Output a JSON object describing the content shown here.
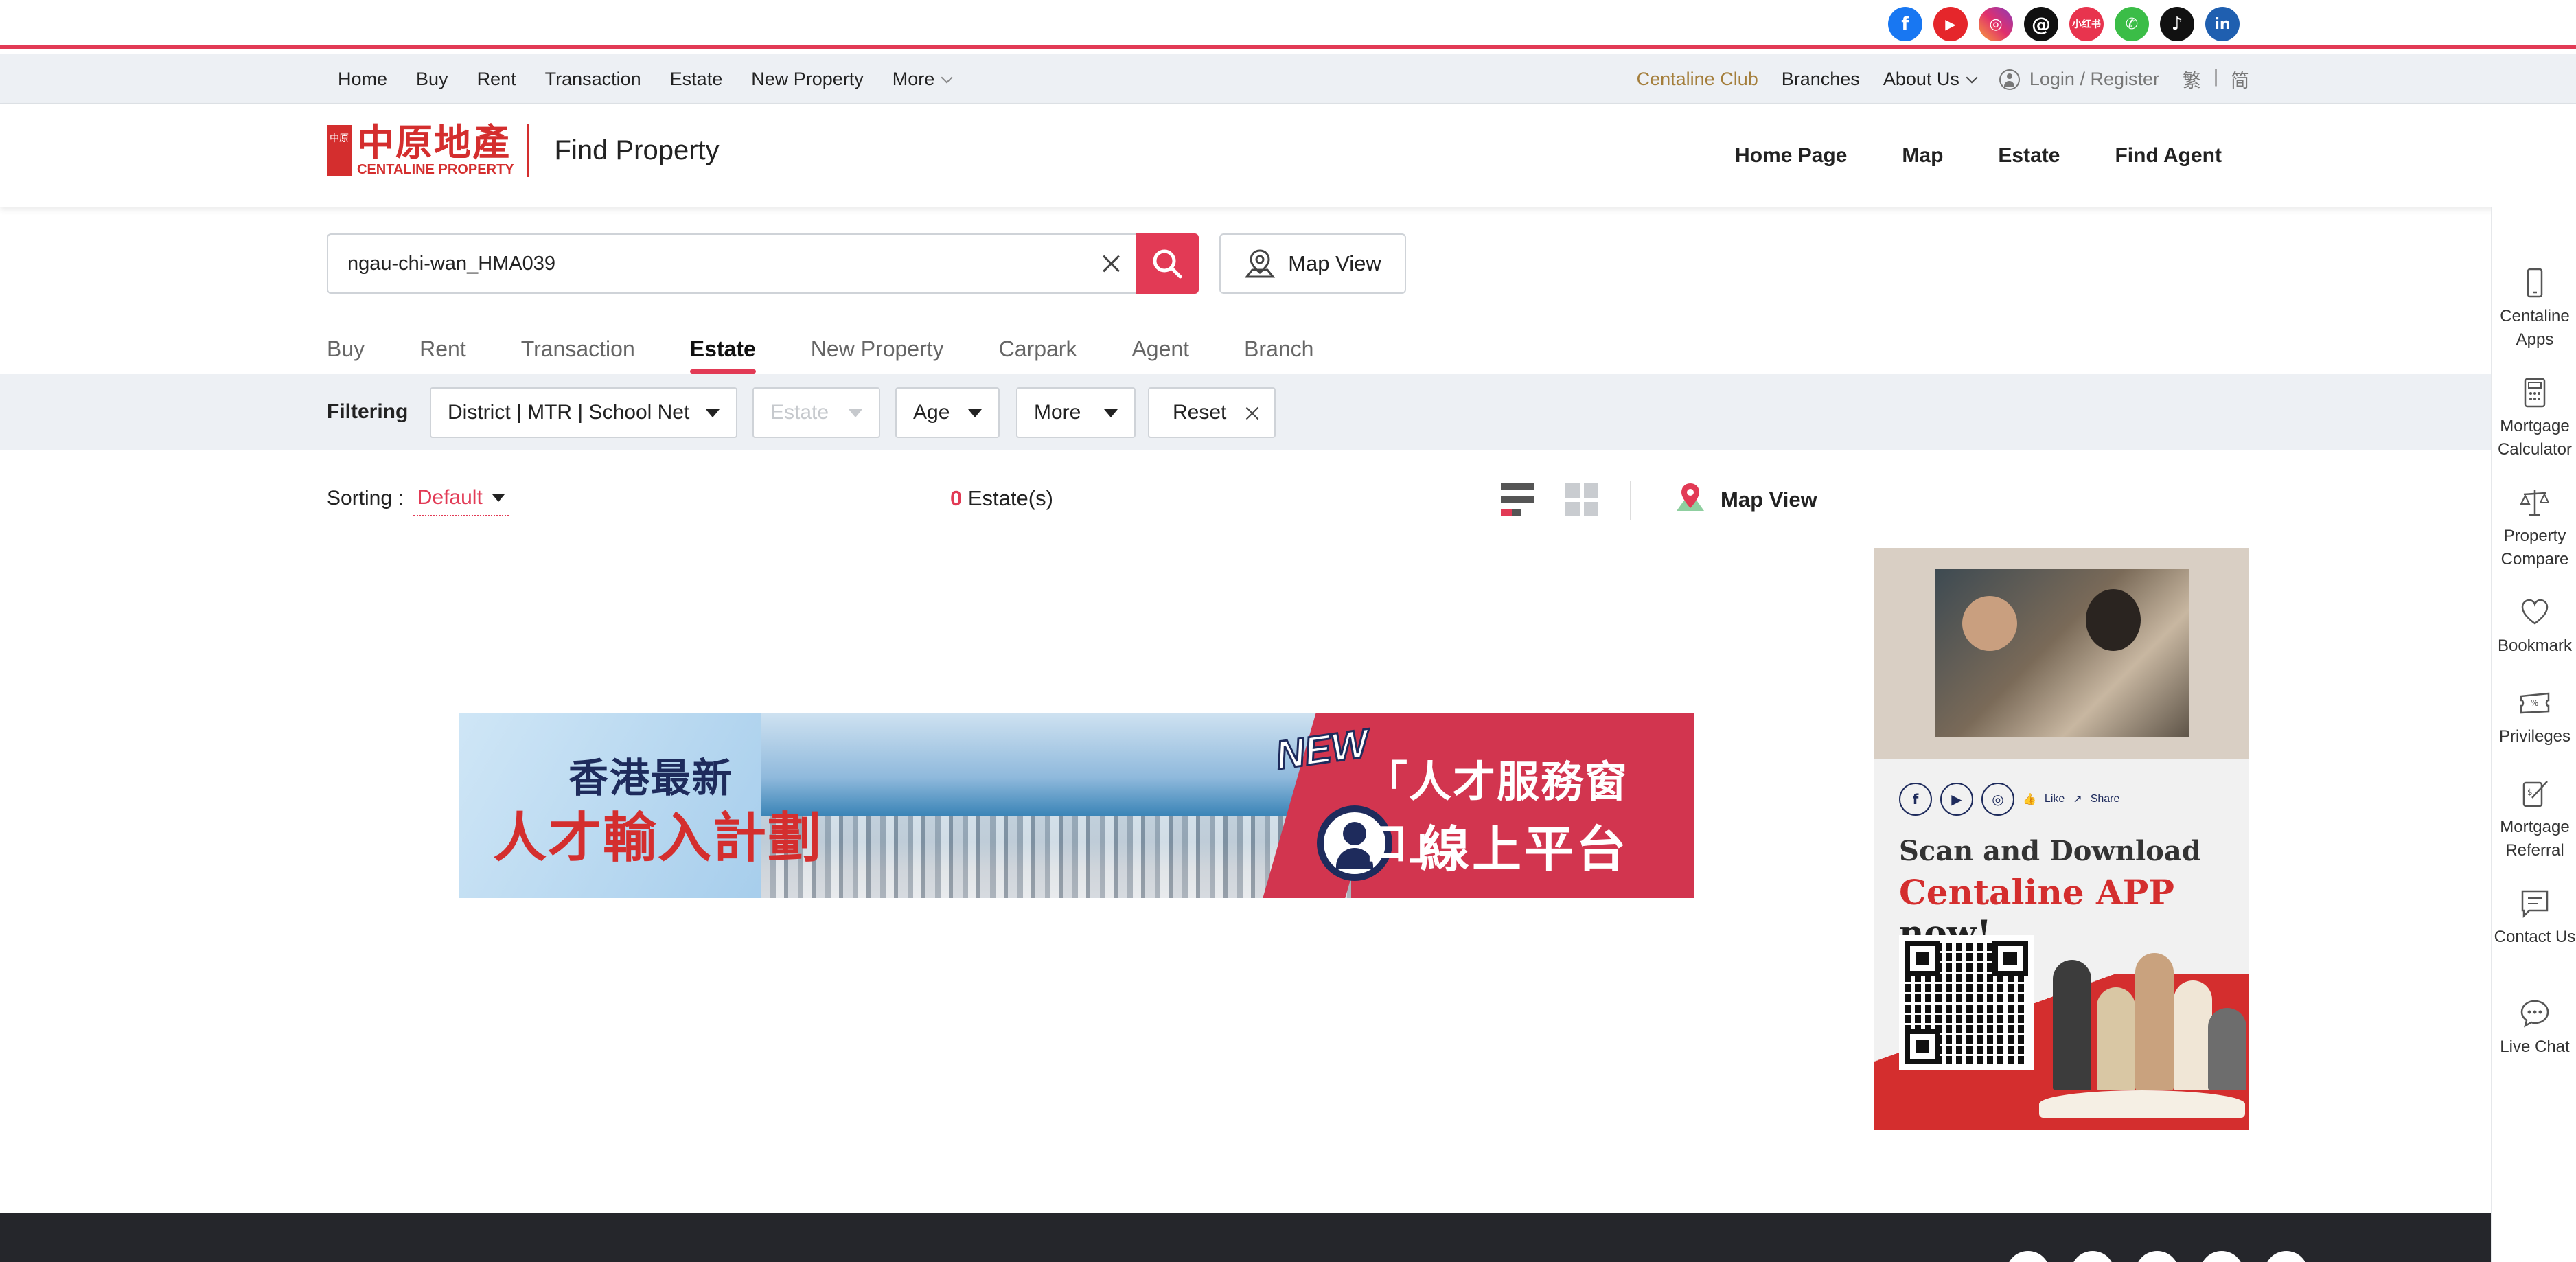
{
  "colors": {
    "brand_red": "#e23a55",
    "logo_red": "#d42e2e",
    "club_gold": "#a47e3b",
    "nav_bg": "#edf0f4",
    "footer_bg": "#25262b"
  },
  "social": [
    {
      "name": "facebook-icon",
      "glyph": "f"
    },
    {
      "name": "youtube-icon",
      "glyph": "▶"
    },
    {
      "name": "instagram-icon",
      "glyph": "◎"
    },
    {
      "name": "threads-icon",
      "glyph": "@"
    },
    {
      "name": "xiaohongshu-icon",
      "glyph": "小红书"
    },
    {
      "name": "wechat-icon",
      "glyph": "✆"
    },
    {
      "name": "tiktok-icon",
      "glyph": "♪"
    },
    {
      "name": "linkedin-icon",
      "glyph": "in"
    }
  ],
  "top_nav": {
    "left": [
      "Home",
      "Buy",
      "Rent",
      "Transaction",
      "Estate",
      "New Property",
      "More"
    ],
    "club": "Centaline Club",
    "branches": "Branches",
    "about": "About Us",
    "login": "Login / Register",
    "lang_trad": "繁",
    "lang_sep": "|",
    "lang_simp": "简"
  },
  "header": {
    "logo_seal": "中原",
    "logo_cn": "中原地產",
    "logo_en": "CENTALINE PROPERTY",
    "title": "Find Property",
    "nav": [
      "Home Page",
      "Map",
      "Estate",
      "Find Agent"
    ]
  },
  "search": {
    "value": "ngau-chi-wan_HMA039",
    "map_view": "Map View"
  },
  "tabs": {
    "items": [
      "Buy",
      "Rent",
      "Transaction",
      "Estate",
      "New Property",
      "Carpark",
      "Agent",
      "Branch"
    ],
    "active": "Estate"
  },
  "filters": {
    "label": "Filtering",
    "district": "District | MTR | School Net",
    "estate": "Estate",
    "age": "Age",
    "more": "More",
    "reset": "Reset"
  },
  "results": {
    "sorting_label": "Sorting :",
    "sorting_value": "Default",
    "count": "0",
    "count_suffix": " Estate(s)",
    "map_view": "Map View"
  },
  "banner": {
    "line1": "香港最新",
    "line2": "人才輸入計劃",
    "new_badge": "NEW",
    "line3": "「人才服務窗口」",
    "line4": "線上平台"
  },
  "side_ad": {
    "like": "Like",
    "share": "Share",
    "scan": "Scan and Download",
    "app": "Centaline APP",
    "now": " now!"
  },
  "side_toolbar": [
    {
      "icon": "phone-icon",
      "label": "Centaline Apps"
    },
    {
      "icon": "calculator-icon",
      "label": "Mortgage Calculator"
    },
    {
      "icon": "scale-icon",
      "label": "Property Compare"
    },
    {
      "icon": "heart-icon",
      "label": "Bookmark"
    },
    {
      "icon": "ticket-icon",
      "label": "Privileges"
    },
    {
      "icon": "referral-icon",
      "label": "Mortgage Referral"
    },
    {
      "icon": "message-icon",
      "label": "Contact Us"
    },
    {
      "icon": "chat-icon",
      "label": "Live Chat"
    }
  ]
}
